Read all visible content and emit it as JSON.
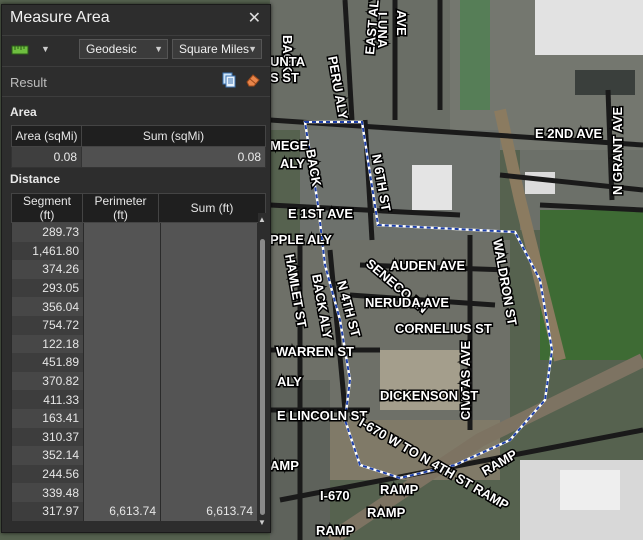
{
  "panel": {
    "title": "Measure Area",
    "close_glyph": "✕",
    "method_select": "Geodesic",
    "units_select": "Square Miles",
    "result_label": "Result",
    "area_section": "Area",
    "distance_section": "Distance",
    "area_table": {
      "headers": [
        "Area (sqMi)",
        "Sum (sqMi)"
      ],
      "row": [
        "0.08",
        "0.08"
      ]
    },
    "distance_table": {
      "headers": [
        "Segment (ft)",
        "Perimeter (ft)",
        "Sum (ft)"
      ],
      "segments": [
        "289.73",
        "1,461.80",
        "374.26",
        "293.05",
        "356.04",
        "754.72",
        "122.18",
        "451.89",
        "370.82",
        "411.33",
        "163.41",
        "310.37",
        "352.14",
        "244.56",
        "339.48",
        "317.97"
      ],
      "perimeter": "6,613.74",
      "sum": "6,613.74"
    },
    "icons": [
      "ruler-icon",
      "copy-icon",
      "eraser-icon",
      "close-icon",
      "chevron-down-icon"
    ]
  },
  "map": {
    "labels": [
      "BACK",
      "LUNA",
      "AVE",
      "PERU ALY",
      "EAST ALY",
      "MEGE",
      "ALY",
      "BACK",
      "N 6TH ST",
      "E 2ND AVE",
      "N GRANT AVE",
      "E 1ST AVE",
      "PPLE ALY",
      "HAMLET ST",
      "BACK ALY",
      "SENECO LN",
      "N 4TH ST",
      "AUDEN AVE",
      "NERUDA AVE",
      "CORNELIUS ST",
      "WALDRON ST",
      "WARREN ST",
      "CIVITAS AVE",
      "ALY",
      "DICKENSON ST",
      "E LINCOLN ST",
      "I-670 W TO N 4TH ST RAMP",
      "RAMP",
      "RAMP",
      "I-670",
      "RAMP",
      "RAMP",
      "UNTA",
      "S ST",
      "AMP"
    ]
  }
}
